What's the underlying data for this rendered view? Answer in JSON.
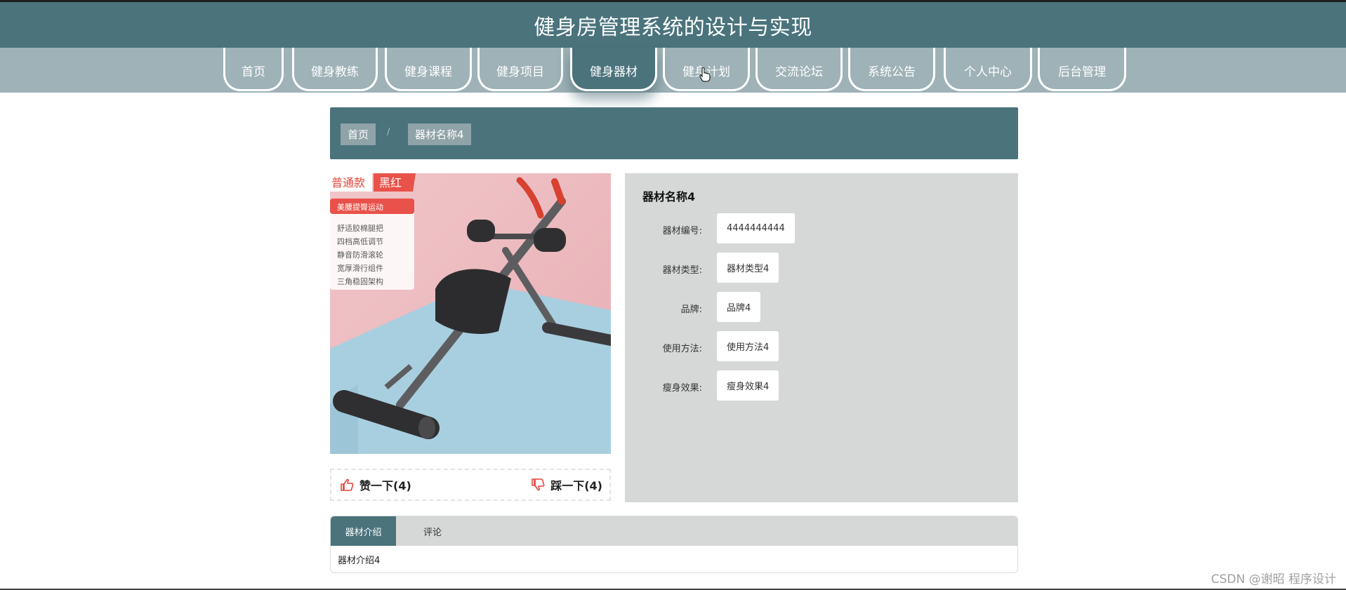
{
  "header": {
    "title": "健身房管理系统的设计与实现"
  },
  "nav": {
    "items": [
      {
        "label": "首页"
      },
      {
        "label": "健身教练"
      },
      {
        "label": "健身课程"
      },
      {
        "label": "健身项目"
      },
      {
        "label": "健身器材",
        "active": true
      },
      {
        "label": "健身计划"
      },
      {
        "label": "交流论坛"
      },
      {
        "label": "系统公告"
      },
      {
        "label": "个人中心"
      },
      {
        "label": "后台管理"
      }
    ]
  },
  "breadcrumb": {
    "home": "首页",
    "separator": "/",
    "current": "器材名称4"
  },
  "image": {
    "badge_left": "普通款",
    "badge_right": "黑红",
    "card_title": "美腰提臀运动",
    "features": [
      "舒适胶棉腿把",
      "四档高低调节",
      "静音防滑滚轮",
      "宽厚滑行组件",
      "三角稳固架构"
    ]
  },
  "votes": {
    "like": "赞一下(4)",
    "dislike": "踩一下(4)"
  },
  "detail": {
    "title": "器材名称4",
    "fields": [
      {
        "label": "器材编号:",
        "value": "4444444444"
      },
      {
        "label": "器材类型:",
        "value": "器材类型4"
      },
      {
        "label": "品牌:",
        "value": "品牌4"
      },
      {
        "label": "使用方法:",
        "value": "使用方法4"
      },
      {
        "label": "瘦身效果:",
        "value": "瘦身效果4"
      }
    ]
  },
  "tabs": {
    "items": [
      {
        "label": "器材介绍",
        "active": true
      },
      {
        "label": "评论"
      }
    ],
    "content": "器材介绍4"
  },
  "watermark": "CSDN @谢昭  程序设计",
  "colors": {
    "primary": "#4a737c",
    "nav_bg": "#9eb2b7",
    "panel_bg": "#d5d8d7",
    "accent_red": "#e0463a"
  }
}
